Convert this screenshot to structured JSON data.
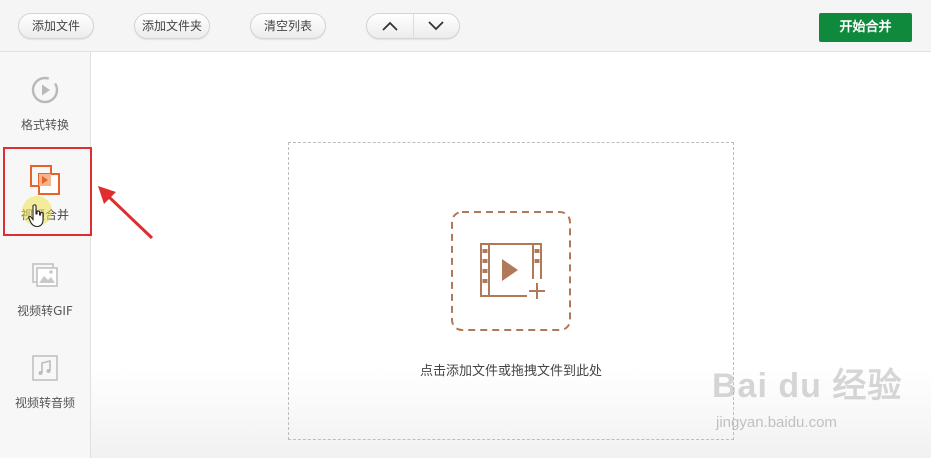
{
  "toolbar": {
    "add_file": "添加文件",
    "add_folder": "添加文件夹",
    "clear_list": "清空列表",
    "move_up_icon": "chevron-up-icon",
    "move_down_icon": "chevron-down-icon",
    "start": "开始合并"
  },
  "sidebar": {
    "items": [
      {
        "label": "格式转换",
        "icon": "play-circle-icon"
      },
      {
        "label": "视频合并",
        "icon": "merge-video-icon",
        "active": true
      },
      {
        "label": "视频转GIF",
        "icon": "image-icon"
      },
      {
        "label": "视频转音频",
        "icon": "music-note-icon"
      }
    ]
  },
  "dropzone": {
    "text": "点击添加文件或拖拽文件到此处",
    "icon": "add-video-icon"
  },
  "watermark": {
    "main": "Bai du 经验",
    "sub": "jingyan.baidu.com"
  },
  "colors": {
    "accent_green": "#0f8a3c",
    "icon_brown": "#b07a5a",
    "active_orange": "#e8632a",
    "highlight_red": "#e02e2e"
  }
}
